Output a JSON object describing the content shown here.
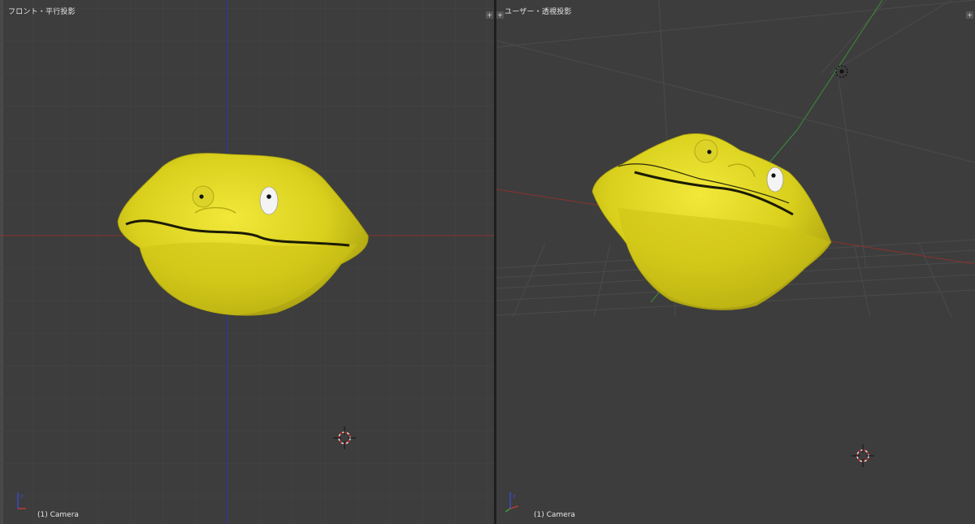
{
  "views": {
    "left": {
      "title": "フロント・平行投影",
      "status": "(1) Camera"
    },
    "right": {
      "title": "ユーザー・透視投影",
      "status": "(1) Camera"
    }
  },
  "colors": {
    "viewport_bg": "#3d3d3d",
    "grid": "#454545",
    "x_axis": "#8c3131",
    "y_axis": "#3c8c3c",
    "z_axis": "#2f2f9a",
    "mesh": "#e6dc1e",
    "mesh_shadow": "#b4ac12"
  },
  "icons": {
    "cursor": "3d-cursor-icon",
    "camera": "camera-object-icon",
    "axis": "axis-gizmo-icon"
  }
}
